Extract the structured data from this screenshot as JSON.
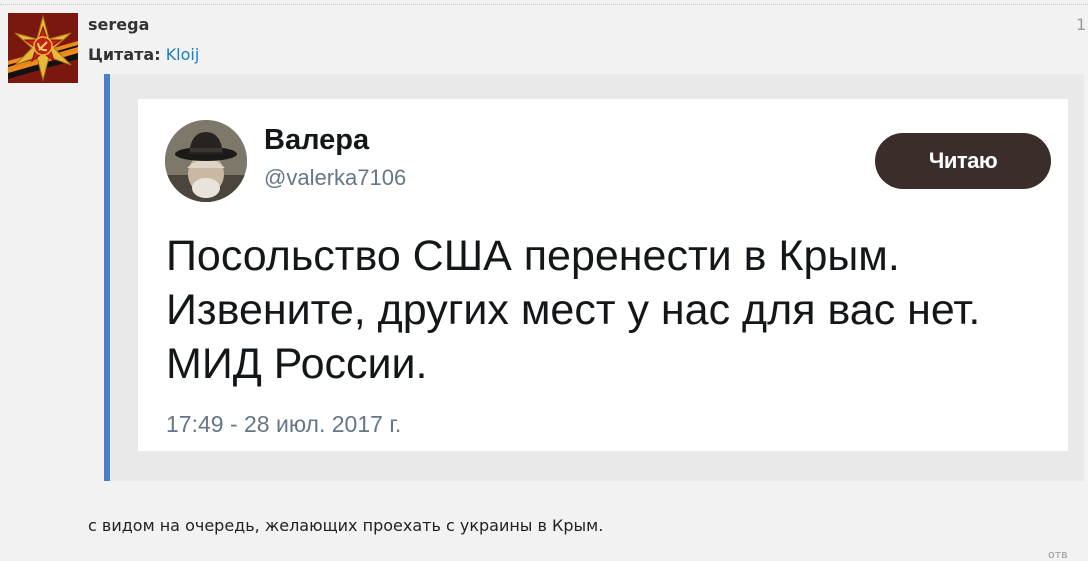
{
  "post": {
    "username": "serega",
    "number": "1",
    "avatar_icon": "soviet-star-sickle-icon",
    "quote_label": "Цитата:",
    "quote_author": "Kloij",
    "body": "с видом на очередь, желающих проехать с украины в Крым.",
    "reply_label": "отв"
  },
  "tweet": {
    "name": "Валера",
    "handle": "@valerka7106",
    "follow_label": "Читаю",
    "lines": [
      "Посольство США перенести в Крым.",
      "Извените, других мест у нас для вас нет.",
      "МИД России."
    ],
    "timestamp": "17:49 - 28 июл. 2017 г."
  },
  "colors": {
    "quote_border": "#4a7fc1",
    "link": "#1a7fbf",
    "follow_button": "#3a2d2a",
    "page_background": "#f2f2f2"
  }
}
